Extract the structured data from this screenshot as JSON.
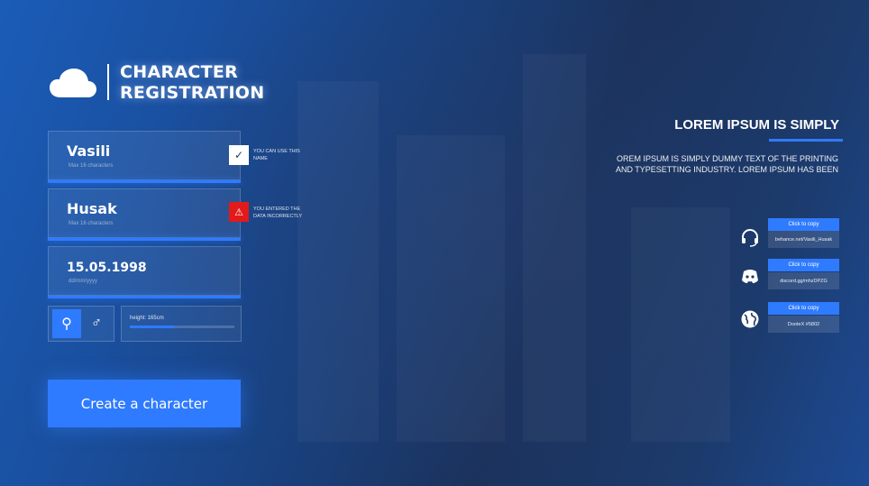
{
  "header": {
    "title_line1": "CHARACTER",
    "title_line2": "REGISTRATION",
    "logo_icon": "cloud-icon"
  },
  "form": {
    "first_name": {
      "value": "Vasili",
      "hint": "Max 16 characters",
      "status": "ok",
      "status_icon": "check-icon",
      "status_text": "YOU CAN USE THIS NAME"
    },
    "last_name": {
      "value": "Husak",
      "hint": "Max 16 characters",
      "status": "error",
      "status_icon": "warning-icon",
      "status_text": "YOU ENTERED THE DATA INCORRECTLY"
    },
    "birthdate": {
      "value": "15.05.1998",
      "hint": "dd/mm/yyyy"
    },
    "gender": {
      "selected": "female",
      "female_icon": "female-icon",
      "male_icon": "male-icon"
    },
    "height": {
      "label": "height: 165cm",
      "level_fraction": 0.42
    },
    "create_label": "Create a character"
  },
  "info": {
    "title": "LOREM IPSUM IS SIMPLY",
    "description": "OREM IPSUM IS SIMPLY DUMMY TEXT OF THE PRINTING AND TYPESETTING INDUSTRY. LOREM IPSUM HAS BEEN"
  },
  "contacts": [
    {
      "icon": "headset-icon",
      "copy_label": "Click to copy",
      "value": "behance.net/Vasili_Husak"
    },
    {
      "icon": "discord-icon",
      "copy_label": "Click to copy",
      "value": "discord.gg/mhzDPZG"
    },
    {
      "icon": "globe-icon",
      "copy_label": "Click to copy",
      "value": "DooteX #5802"
    }
  ],
  "colors": {
    "accent": "#2f7bff",
    "error": "#e21a1a",
    "background": "#1b3f7a"
  }
}
